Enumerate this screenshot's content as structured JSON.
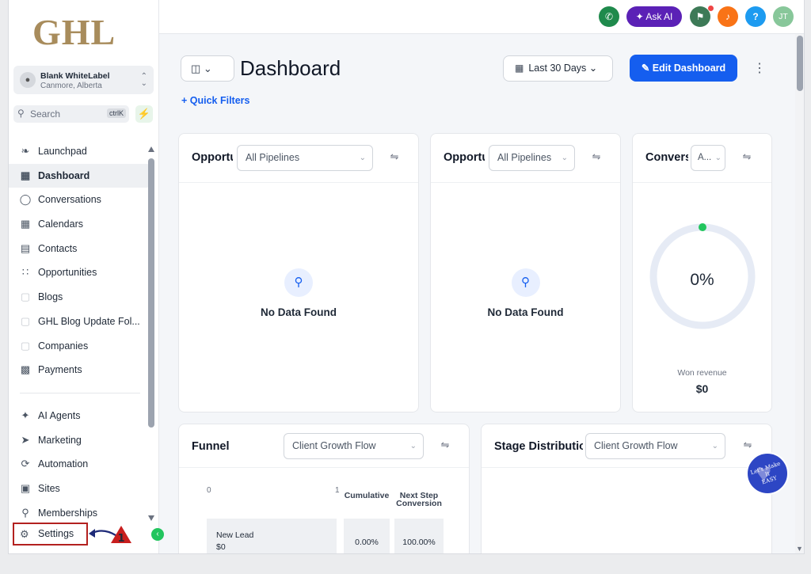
{
  "brand": {
    "logo_text": "GHL"
  },
  "account": {
    "name": "Blank WhiteLabel",
    "location": "Canmore, Alberta"
  },
  "search": {
    "placeholder": "Search",
    "shortcut": "ctrlK"
  },
  "sidebar": {
    "items": [
      {
        "label": "Launchpad",
        "icon": "rocket-icon"
      },
      {
        "label": "Dashboard",
        "icon": "grid-icon",
        "active": true
      },
      {
        "label": "Conversations",
        "icon": "chat-icon"
      },
      {
        "label": "Calendars",
        "icon": "calendar-icon"
      },
      {
        "label": "Contacts",
        "icon": "contact-card-icon"
      },
      {
        "label": "Opportunities",
        "icon": "pipeline-icon"
      },
      {
        "label": "Blogs",
        "icon": "cube-icon"
      },
      {
        "label": "GHL Blog Update Fol...",
        "icon": "cube-icon"
      },
      {
        "label": "Companies",
        "icon": "cube-icon"
      },
      {
        "label": "Payments",
        "icon": "receipt-icon"
      }
    ],
    "items2": [
      {
        "label": "AI Agents",
        "icon": "sparkle-icon"
      },
      {
        "label": "Marketing",
        "icon": "send-icon"
      },
      {
        "label": "Automation",
        "icon": "automation-icon"
      },
      {
        "label": "Sites",
        "icon": "site-icon"
      },
      {
        "label": "Memberships",
        "icon": "award-icon"
      }
    ],
    "settings_label": "Settings",
    "annotation_number": "1"
  },
  "topbar": {
    "ask_ai_label": "Ask AI",
    "help_label": "?",
    "user_initials": "JT"
  },
  "header": {
    "title": "Dashboard",
    "date_range": "Last 30 Days",
    "edit_label": "Edit Dashboard",
    "quick_filters_label": "+ Quick Filters"
  },
  "cards": {
    "opp1": {
      "title": "Opportu",
      "select": "All Pipelines",
      "empty": "No Data Found"
    },
    "opp2": {
      "title": "Opportu",
      "select": "All Pipelines",
      "empty": "No Data Found"
    },
    "conv": {
      "title": "Convers",
      "select": "A...",
      "percent": "0%",
      "progress_pct": 0,
      "won_label": "Won revenue",
      "won_value": "$0"
    },
    "funnel": {
      "title": "Funnel",
      "select": "Client Growth Flow",
      "axis_min": "0",
      "axis_max": "1",
      "col_cumulative": "Cumulative",
      "col_next_l1": "Next Step",
      "col_next_l2": "Conversion",
      "stage_name": "New Lead",
      "stage_value": "$0",
      "cumulative": "0.00%",
      "next_step": "100.00%"
    },
    "stage": {
      "title": "Stage Distributio",
      "select": "Client Growth Flow"
    }
  },
  "badge": {
    "line1": "Let's Make",
    "line2": "It",
    "line3": "EASY"
  },
  "colors": {
    "primary": "#155eef",
    "brand_gold": "#a88c5c",
    "success": "#22c55e",
    "annotation": "#b3211f"
  }
}
